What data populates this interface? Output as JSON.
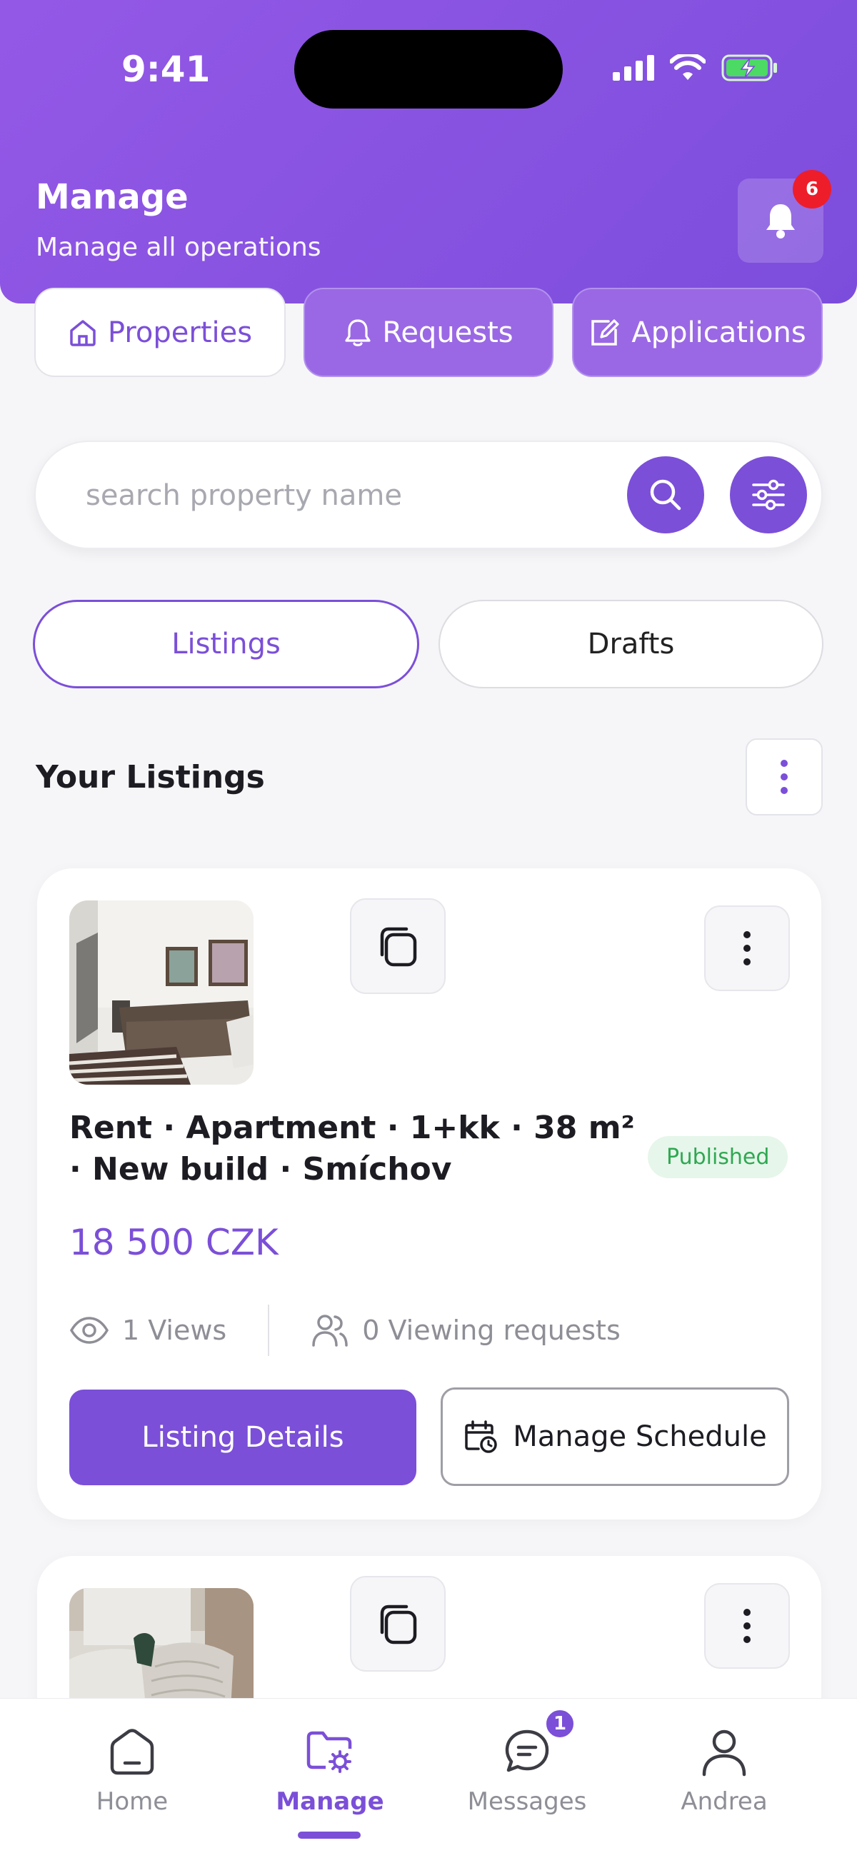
{
  "status_bar": {
    "time": "9:41"
  },
  "header": {
    "title": "Manage",
    "subtitle": "Manage all operations",
    "notification_count": "6"
  },
  "top_tabs": [
    {
      "label": "Properties",
      "icon": "home-icon",
      "active": true
    },
    {
      "label": "Requests",
      "icon": "bell-icon",
      "active": false
    },
    {
      "label": "Applications",
      "icon": "edit-icon",
      "active": false
    }
  ],
  "search": {
    "placeholder": "search property name",
    "value": ""
  },
  "segments": {
    "listings": "Listings",
    "drafts": "Drafts"
  },
  "section": {
    "title": "Your Listings"
  },
  "listings": [
    {
      "title": "Rent · Apartment · 1+kk · 38 m² · New build · Smíchov",
      "status": "Published",
      "price": "18 500 CZK",
      "views": "1 Views",
      "viewing_requests": "0 Viewing requests",
      "primary_action": "Listing Details",
      "secondary_action": "Manage Schedule"
    }
  ],
  "bottom_nav": [
    {
      "label": "Home",
      "icon": "home-icon"
    },
    {
      "label": "Manage",
      "icon": "folder-settings-icon",
      "active": true
    },
    {
      "label": "Messages",
      "icon": "chat-icon",
      "badge": "1"
    },
    {
      "label": "Andrea",
      "icon": "user-icon"
    }
  ],
  "colors": {
    "accent": "#7b4fd8",
    "header": "#8a55e2",
    "badge_red": "#ee1d2a",
    "published_bg": "#e6f6ea",
    "published_text": "#2fa852"
  }
}
